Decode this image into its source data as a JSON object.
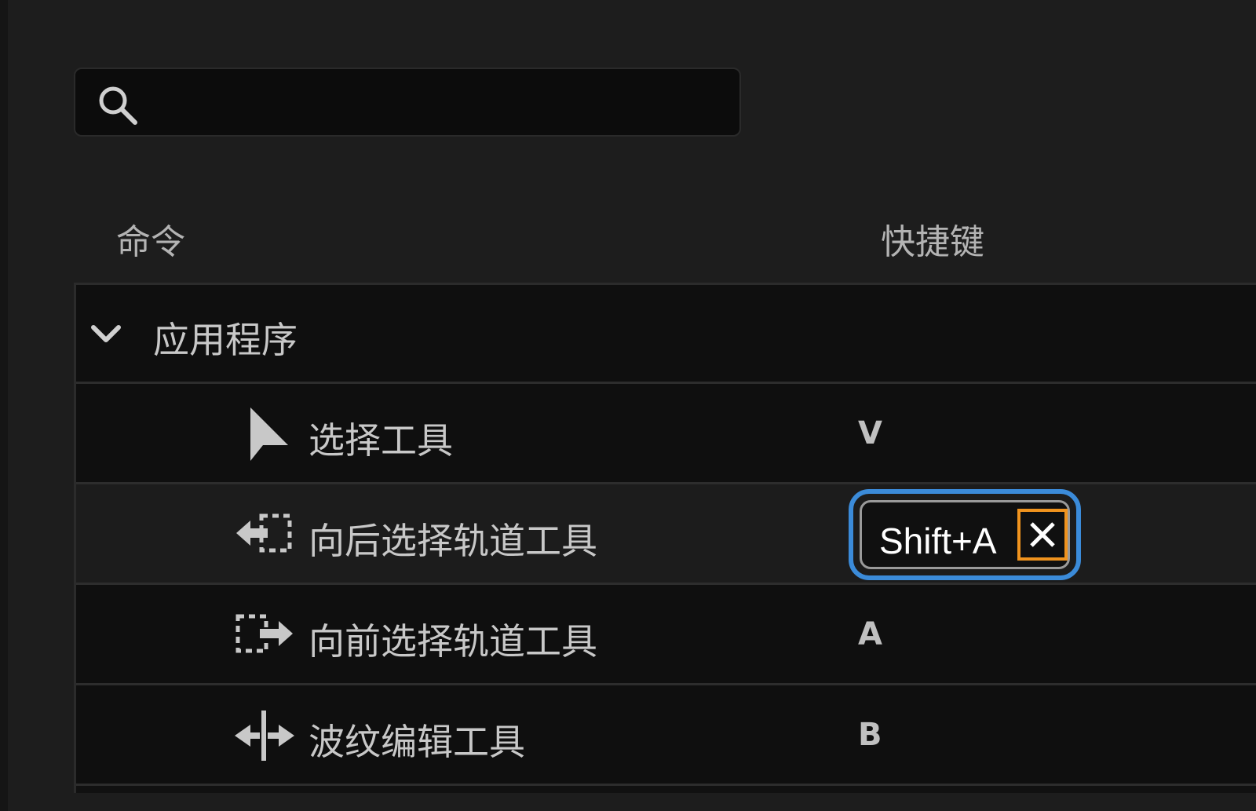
{
  "search": {
    "value": "",
    "placeholder": "",
    "icon": "search-icon"
  },
  "headers": {
    "command": "命令",
    "shortcut": "快捷键"
  },
  "group": {
    "label": "应用程序",
    "expanded": true,
    "icon": "chevron-down-icon"
  },
  "items": [
    {
      "label": "选择工具",
      "icon": "selection-arrow-icon",
      "shortcut": "V"
    },
    {
      "label": "向后选择轨道工具",
      "icon": "track-select-backward-icon",
      "shortcut": "Shift+A",
      "editing": true
    },
    {
      "label": "向前选择轨道工具",
      "icon": "track-select-forward-icon",
      "shortcut": "A"
    },
    {
      "label": "波纹编辑工具",
      "icon": "ripple-edit-icon",
      "shortcut": "B"
    }
  ],
  "colors": {
    "accent_focus": "#3b8bd9",
    "clear_highlight": "#f0931e",
    "background": "#1d1d1d"
  }
}
